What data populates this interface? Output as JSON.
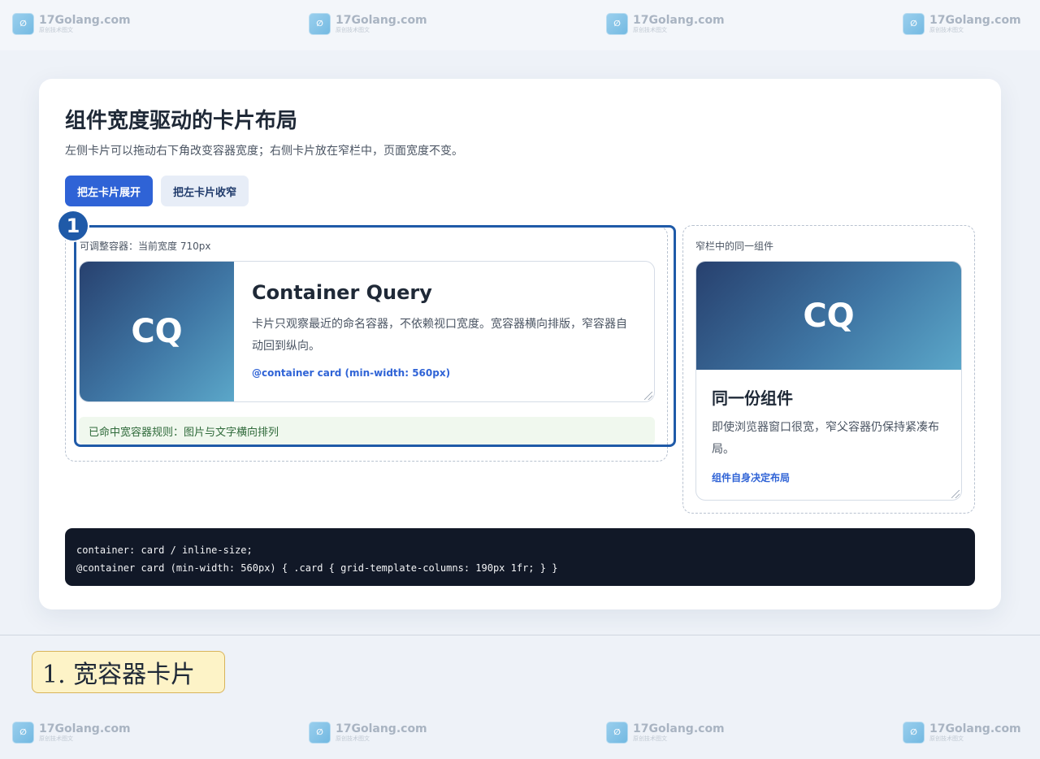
{
  "watermark": {
    "name": "17Golang.com",
    "sub": "原创技术图文"
  },
  "panel": {
    "title": "组件宽度驱动的卡片布局",
    "subtitle": "左侧卡片可以拖动右下角改变容器宽度；右侧卡片放在窄栏中，页面宽度不变。",
    "buttons": {
      "expand": "把左卡片展开",
      "collapse": "把左卡片收窄"
    }
  },
  "left": {
    "badge": "1",
    "label": "可调整容器：当前宽度 710px",
    "card": {
      "thumb": "CQ",
      "title": "Container Query",
      "text": "卡片只观察最近的命名容器，不依赖视口宽度。宽容器横向排版，窄容器自动回到纵向。",
      "code": "@container card (min-width: 560px)"
    },
    "status": "已命中宽容器规则：图片与文字横向排列"
  },
  "right": {
    "label": "窄栏中的同一组件",
    "card": {
      "thumb": "CQ",
      "title": "同一份组件",
      "text": "即使浏览器窗口很宽，窄父容器仍保持紧凑布局。",
      "link": "组件自身决定布局"
    }
  },
  "code": {
    "line1": "container: card / inline-size;",
    "line2": "@container card (min-width: 560px) { .card { grid-template-columns: 190px 1fr; } }"
  },
  "caption": "1. 宽容器卡片"
}
